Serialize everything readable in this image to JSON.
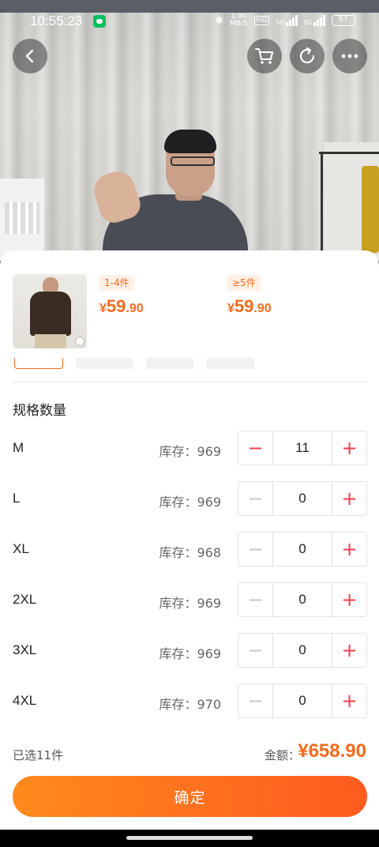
{
  "status_bar": {
    "time": "10:55:23",
    "net_speed_value": "1.90",
    "net_speed_unit": "MB/S",
    "hd_label": "HD",
    "sig1_label": "5G",
    "sig2_label": "5G",
    "battery": "67"
  },
  "product": {
    "tiers": [
      {
        "range": "1-4件",
        "currency": "¥",
        "price_int": "59",
        "price_dec": ".90"
      },
      {
        "range": "≥5件",
        "currency": "¥",
        "price_int": "59",
        "price_dec": ".90"
      }
    ]
  },
  "section_title": "规格数量",
  "sizes": [
    {
      "name": "M",
      "stock": "库存：969",
      "qty": "11",
      "minus_active": true
    },
    {
      "name": "L",
      "stock": "库存：969",
      "qty": "0",
      "minus_active": false
    },
    {
      "name": "XL",
      "stock": "库存：968",
      "qty": "0",
      "minus_active": false
    },
    {
      "name": "2XL",
      "stock": "库存：969",
      "qty": "0",
      "minus_active": false
    },
    {
      "name": "3XL",
      "stock": "库存：969",
      "qty": "0",
      "minus_active": false
    },
    {
      "name": "4XL",
      "stock": "库存：970",
      "qty": "0",
      "minus_active": false
    }
  ],
  "summary": {
    "selected": "已选11件",
    "amount_label": "金额：",
    "amount": "¥658.90"
  },
  "confirm_label": "确定",
  "stepper": {
    "minus": "−",
    "plus": "+"
  },
  "colors": {
    "accent": "#f36b1c",
    "stepper_red": "#f23d4f",
    "button_start": "#ff8a1c",
    "button_end": "#ff5a1f"
  }
}
